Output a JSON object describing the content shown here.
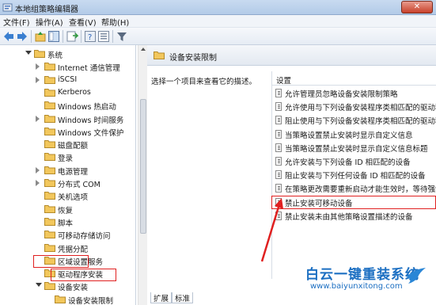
{
  "window": {
    "title": "本地组策略编辑器",
    "close_label": "✕"
  },
  "menu": [
    "文件(F)",
    "操作(A)",
    "查看(V)",
    "帮助(H)"
  ],
  "tree": {
    "items": [
      {
        "label": "系统",
        "expander": "open",
        "indent": 0
      },
      {
        "label": "Internet 通信管理",
        "expander": "closed",
        "indent": 1
      },
      {
        "label": "iSCSI",
        "expander": "closed",
        "indent": 1
      },
      {
        "label": "Kerberos",
        "expander": "none",
        "indent": 1
      },
      {
        "label": "Windows 热启动",
        "expander": "none",
        "indent": 1
      },
      {
        "label": "Windows 时间服务",
        "expander": "closed",
        "indent": 1
      },
      {
        "label": "Windows 文件保护",
        "expander": "none",
        "indent": 1
      },
      {
        "label": "磁盘配额",
        "expander": "none",
        "indent": 1
      },
      {
        "label": "登录",
        "expander": "none",
        "indent": 1
      },
      {
        "label": "电源管理",
        "expander": "closed",
        "indent": 1
      },
      {
        "label": "分布式 COM",
        "expander": "closed",
        "indent": 1
      },
      {
        "label": "关机选项",
        "expander": "none",
        "indent": 1
      },
      {
        "label": "恢复",
        "expander": "none",
        "indent": 1
      },
      {
        "label": "脚本",
        "expander": "none",
        "indent": 1
      },
      {
        "label": "可移动存储访问",
        "expander": "none",
        "indent": 1
      },
      {
        "label": "凭据分配",
        "expander": "none",
        "indent": 1
      },
      {
        "label": "区域设置服务",
        "expander": "none",
        "indent": 1
      },
      {
        "label": "驱动程序安装",
        "expander": "none",
        "indent": 1
      },
      {
        "label": "设备安装",
        "expander": "open",
        "indent": 1
      },
      {
        "label": "设备安装限制",
        "expander": "none",
        "indent": 2
      },
      {
        "label": "设备重定向",
        "expander": "closed",
        "indent": 1
      }
    ]
  },
  "right_pane": {
    "header_title": "设备安装限制",
    "description": "选择一个项目来查看它的描述。",
    "column_header": "设置",
    "settings": [
      "允许管理员忽略设备安装限制策略",
      "允许使用与下列设备安装程序类相匹配的驱动程序",
      "阻止使用与下列设备安装程序类相匹配的驱动程序",
      "当策略设置禁止安装时显示自定义信息",
      "当策略设置禁止安装时显示自定义信息标题",
      "允许安装与下列设备 ID 相匹配的设备",
      "阻止安装与下列任何设备 ID 相匹配的设备",
      "在策略更改需要重新启动才能生效时，等待强制重",
      "禁止安装可移动设备",
      "禁止安装未由其他策略设置描述的设备"
    ],
    "tabs": [
      "扩展",
      "标准"
    ]
  },
  "watermark": {
    "title": "白云一键重装系统",
    "url": "www.baiyunxitong.com"
  },
  "colors": {
    "highlight_red": "#e02020",
    "watermark_blue": "#1c6fc2",
    "folder_yellow": "#f2c75c"
  }
}
